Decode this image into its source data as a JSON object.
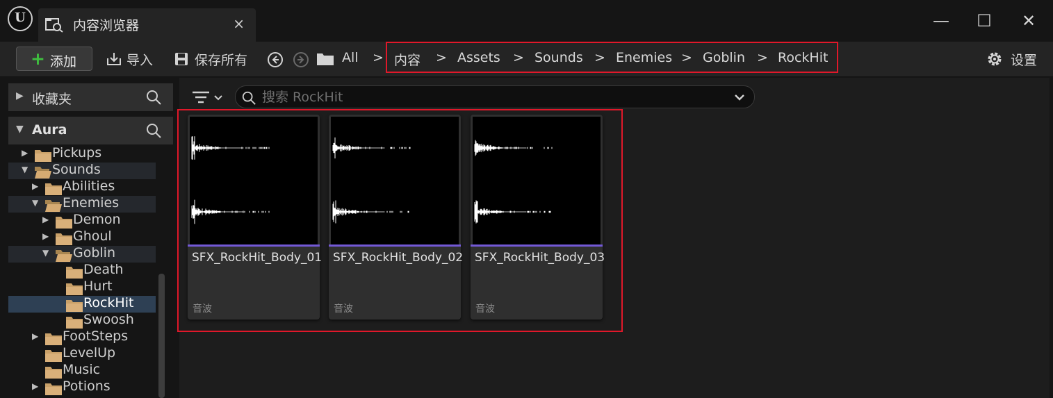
{
  "window": {
    "logo_glyph": "U",
    "tab_title": "内容浏览器",
    "tab_close": "×",
    "controls": {
      "minimize": "—",
      "maximize": "☐",
      "close": "✕"
    }
  },
  "toolbar": {
    "add_label": "添加",
    "import_label": "导入",
    "save_all_label": "保存所有",
    "settings_label": "设置",
    "path_root": "All",
    "separator": ">"
  },
  "breadcrumb": [
    "内容",
    "Assets",
    "Sounds",
    "Enemies",
    "Goblin",
    "RockHit"
  ],
  "sidebar": {
    "favorites_label": "收藏夹",
    "root_label": "Aura",
    "tree": [
      {
        "name": "Pickups",
        "depth": 3,
        "expanded": false,
        "has_children": true,
        "state": ""
      },
      {
        "name": "Sounds",
        "depth": 3,
        "expanded": true,
        "has_children": true,
        "state": "hl"
      },
      {
        "name": "Abilities",
        "depth": 4,
        "expanded": false,
        "has_children": true,
        "state": ""
      },
      {
        "name": "Enemies",
        "depth": 4,
        "expanded": true,
        "has_children": true,
        "state": "hl"
      },
      {
        "name": "Demon",
        "depth": 5,
        "expanded": false,
        "has_children": true,
        "state": ""
      },
      {
        "name": "Ghoul",
        "depth": 5,
        "expanded": false,
        "has_children": true,
        "state": ""
      },
      {
        "name": "Goblin",
        "depth": 5,
        "expanded": true,
        "has_children": true,
        "state": "hl"
      },
      {
        "name": "Death",
        "depth": 6,
        "expanded": false,
        "has_children": false,
        "state": ""
      },
      {
        "name": "Hurt",
        "depth": 6,
        "expanded": false,
        "has_children": false,
        "state": ""
      },
      {
        "name": "RockHit",
        "depth": 6,
        "expanded": false,
        "has_children": false,
        "state": "sel"
      },
      {
        "name": "Swoosh",
        "depth": 6,
        "expanded": false,
        "has_children": false,
        "state": ""
      },
      {
        "name": "FootSteps",
        "depth": 4,
        "expanded": false,
        "has_children": true,
        "state": ""
      },
      {
        "name": "LevelUp",
        "depth": 4,
        "expanded": false,
        "has_children": false,
        "state": ""
      },
      {
        "name": "Music",
        "depth": 4,
        "expanded": false,
        "has_children": false,
        "state": ""
      },
      {
        "name": "Potions",
        "depth": 4,
        "expanded": false,
        "has_children": true,
        "state": ""
      }
    ]
  },
  "search": {
    "placeholder": "搜索 RockHit"
  },
  "assets": [
    {
      "name": "SFX_RockHit_Body_01",
      "type": "音波",
      "icon": "soundwave-thumbnail"
    },
    {
      "name": "SFX_RockHit_Body_02",
      "type": "音波",
      "icon": "soundwave-thumbnail"
    },
    {
      "name": "SFX_RockHit_Body_03",
      "type": "音波",
      "icon": "soundwave-thumbnail"
    }
  ],
  "colors": {
    "highlight_border": "#e0182a",
    "soundwave_bar": "#7359d6",
    "folder": "#c9a068",
    "add_plus": "#3fbf3f"
  }
}
